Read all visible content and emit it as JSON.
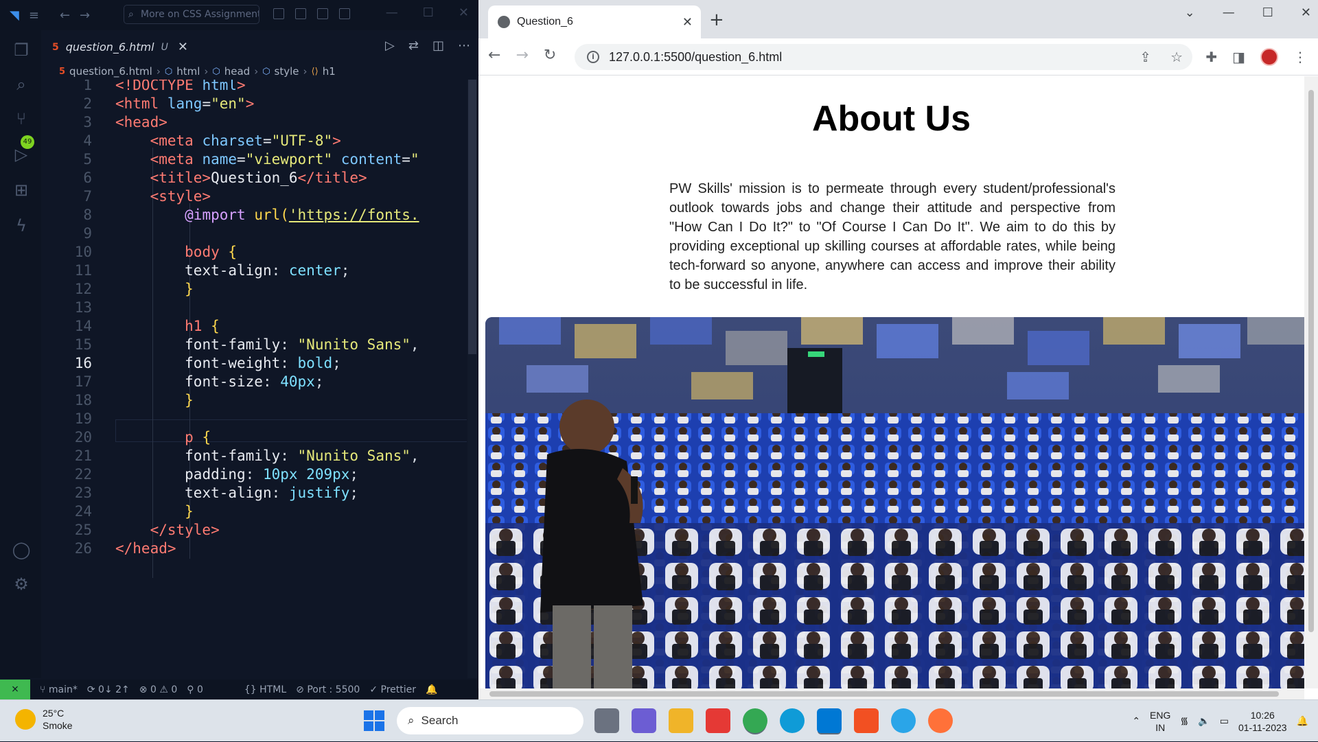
{
  "vscode": {
    "command_center": "More on CSS Assignment",
    "tab": {
      "name": "question_6.html",
      "status": "U"
    },
    "breadcrumb": [
      "question_6.html",
      "html",
      "head",
      "style",
      "h1"
    ],
    "source_control_badge": "49",
    "current_line": 16,
    "status": {
      "branch": "main*",
      "sync": "0↓ 2↑",
      "errors": "0",
      "warnings": "0",
      "ports": "0",
      "language": "HTML",
      "port": "Port : 5500",
      "formatter": "Prettier"
    }
  },
  "browser": {
    "tab_title": "Question_6",
    "url": "127.0.0.1:5500/question_6.html",
    "page": {
      "heading": "About Us",
      "paragraph": "PW Skills' mission is to permeate through every student/professional's outlook towards jobs and change their attitude and perspective from \"How Can I Do It?\" to \"Of Course I Can Do It\". We aim to do this by providing exceptional up skilling courses at affordable rates, while being tech-forward so anyone, anywhere can access and improve their ability to be successful in life."
    }
  },
  "taskbar": {
    "weather_temp": "25°C",
    "weather_desc": "Smoke",
    "search_placeholder": "Search",
    "lang_top": "ENG",
    "lang_bottom": "IN",
    "time": "10:26",
    "date": "01-11-2023"
  }
}
